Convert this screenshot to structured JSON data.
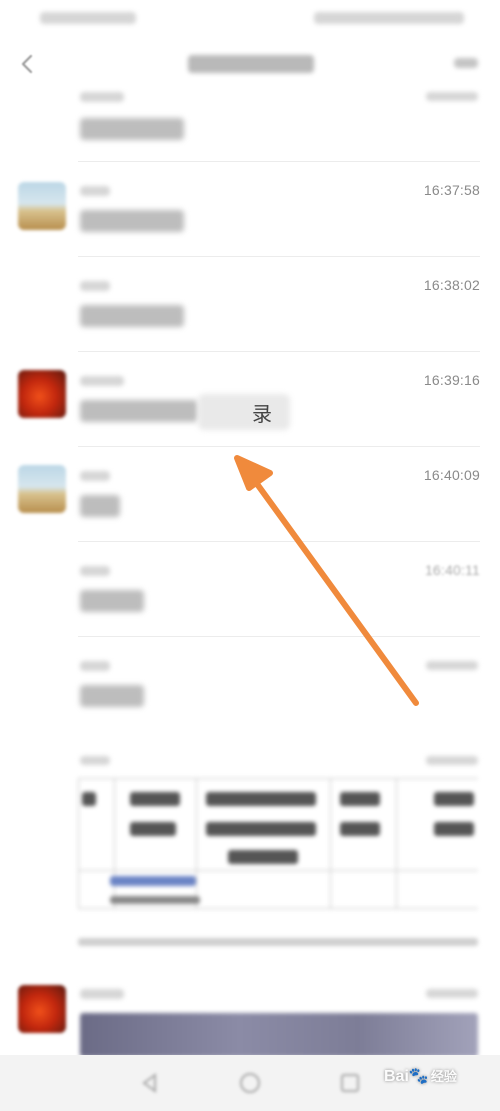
{
  "colors": {
    "annotation_arrow": "#f08a3c",
    "timestamp": "#8a8a8a",
    "divider": "#ececec"
  },
  "header": {
    "back_icon": "chevron-left-icon",
    "more_icon": "ellipsis-icon"
  },
  "messages": [
    {
      "avatar": "none",
      "time": ""
    },
    {
      "avatar": "landscape-avatar",
      "time": "16:37:58"
    },
    {
      "avatar": "none",
      "time": "16:38:02"
    },
    {
      "avatar": "fire-avatar",
      "time": "16:39:16",
      "partial_char": "录"
    },
    {
      "avatar": "landscape-avatar",
      "time": "16:40:09"
    },
    {
      "avatar": "none",
      "time": "16:40:11"
    }
  ],
  "navbar": {
    "icons": [
      "back-triangle-icon",
      "home-circle-icon",
      "recent-square-icon"
    ]
  },
  "watermark": {
    "brand": "Bai",
    "suffix": "经验"
  }
}
